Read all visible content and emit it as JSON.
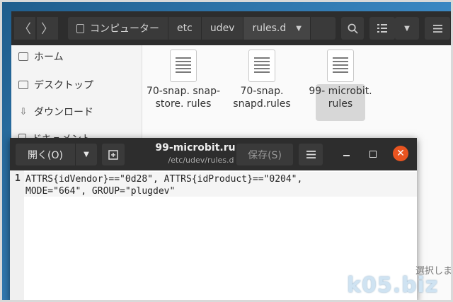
{
  "files_window": {
    "breadcrumbs": [
      "コンピューター",
      "etc",
      "udev",
      "rules.d"
    ],
    "sidebar": [
      "ホーム",
      "デスクトップ",
      "ダウンロード",
      "ドキュメント"
    ],
    "files": [
      {
        "name": "70-snap. snap-store. rules",
        "selected": false
      },
      {
        "name": "70-snap. snapd.rules",
        "selected": false
      },
      {
        "name": "99- microbit. rules",
        "selected": true
      }
    ]
  },
  "editor_window": {
    "open_label": "開く(O)",
    "title": "99-microbit.ru...",
    "subtitle": "/etc/udev/rules.d",
    "save_label": "保存(S)",
    "line_number": "1",
    "content": "ATTRS{idVendor}==\"0d28\", ATTRS{idProduct}==\"0204\", MODE=\"664\", GROUP=\"plugdev\""
  },
  "background_partial_text": "選択しま",
  "watermark": "k05.biz",
  "colors": {
    "accent_close": "#e95420",
    "headerbar": "#2d2d2d"
  }
}
